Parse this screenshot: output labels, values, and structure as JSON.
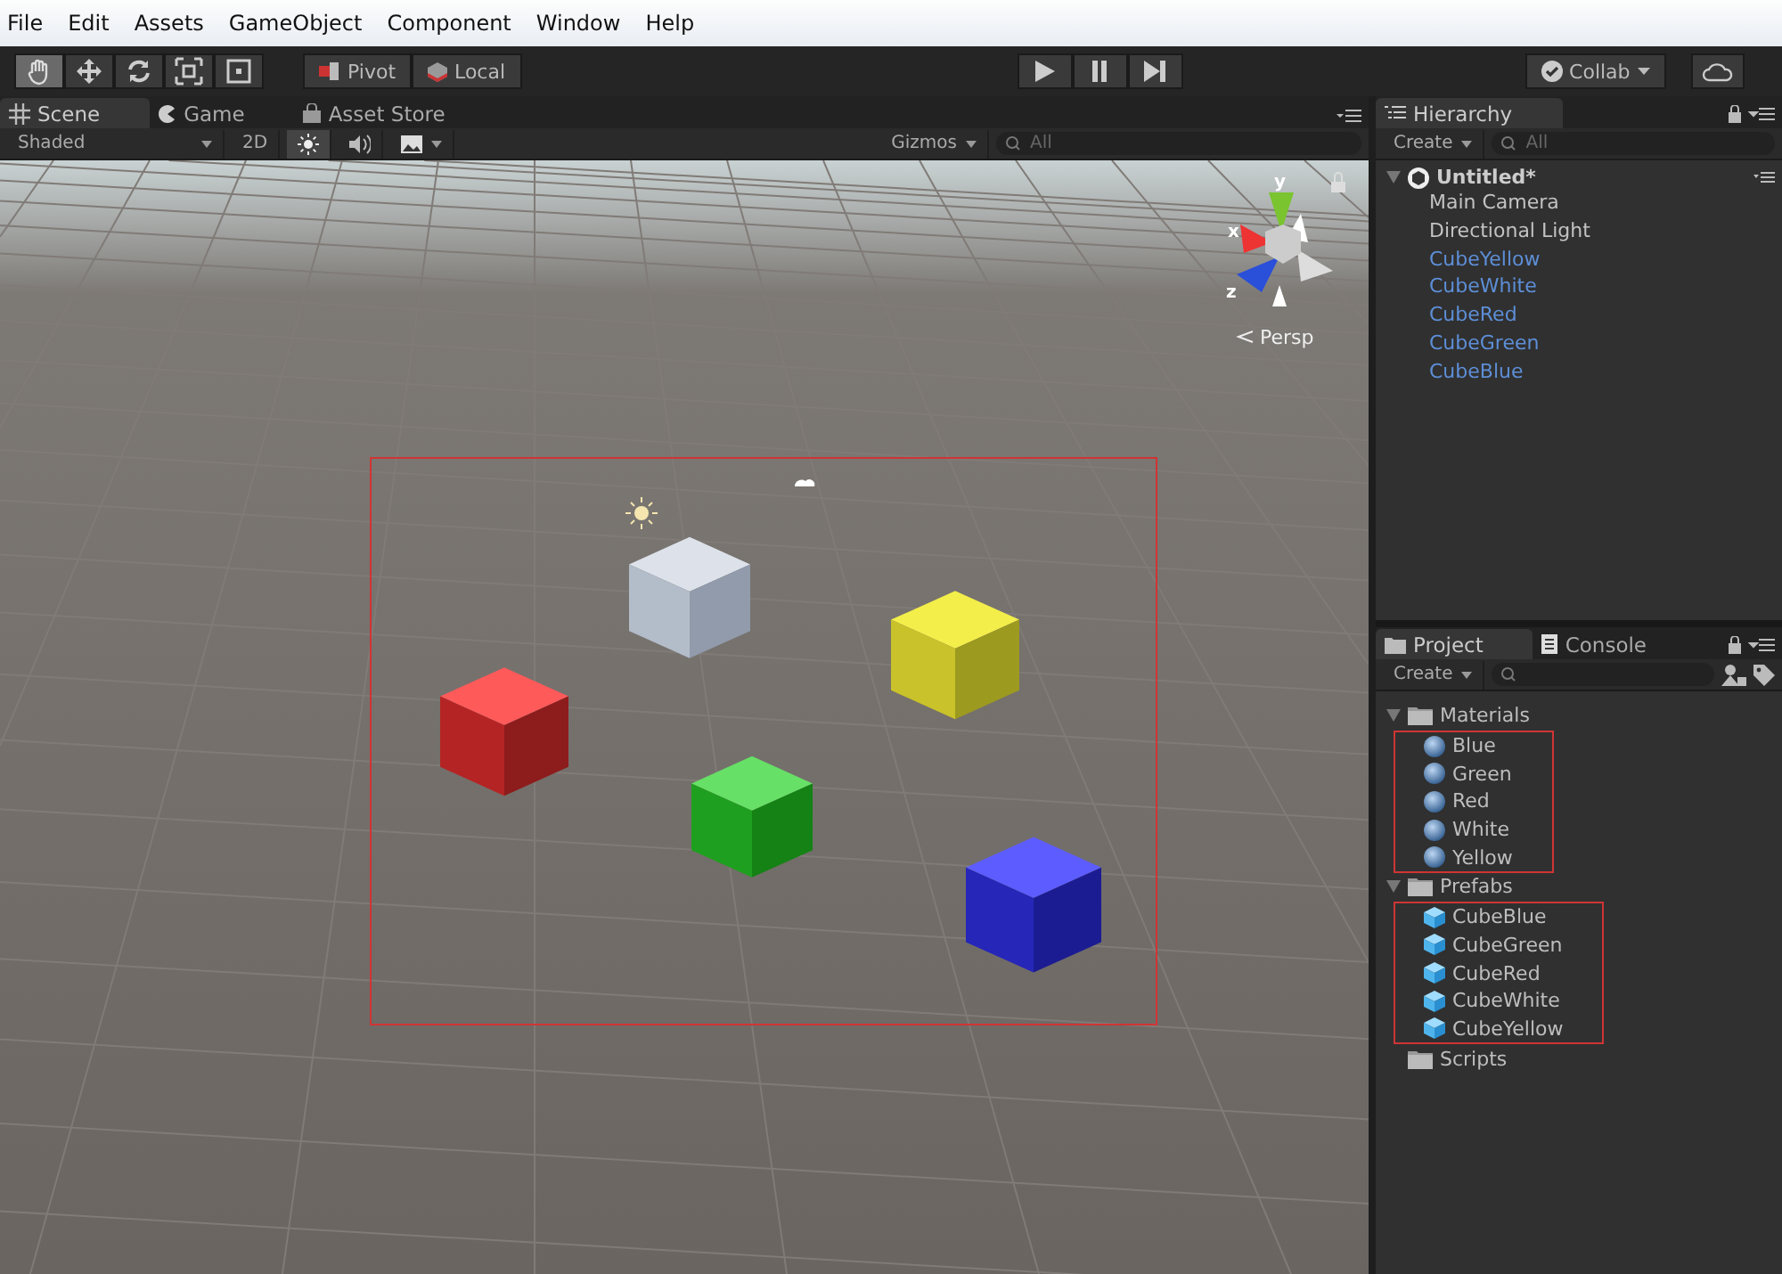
{
  "menu": [
    "File",
    "Edit",
    "Assets",
    "GameObject",
    "Component",
    "Window",
    "Help"
  ],
  "toolbar": {
    "tools": [
      {
        "kind": "hand",
        "selected": true
      },
      {
        "kind": "move",
        "selected": false
      },
      {
        "kind": "rotate",
        "selected": false
      },
      {
        "kind": "scale",
        "selected": false
      },
      {
        "kind": "rect",
        "selected": false
      }
    ],
    "pivot": "Pivot",
    "local": "Local",
    "collab": "Collab"
  },
  "scene_tabs": [
    {
      "label": "Scene",
      "kind": "scene",
      "selected": true
    },
    {
      "label": "Game",
      "kind": "game",
      "selected": false
    },
    {
      "label": "Asset Store",
      "kind": "store",
      "selected": false
    }
  ],
  "scene_toolbar": {
    "shading": "Shaded",
    "mode_2d": "2D",
    "lighting_on": true,
    "audio_on": false,
    "effects_on": false,
    "gizmos": "Gizmos",
    "search_placeholder": "All"
  },
  "gizmo": {
    "y": "y",
    "x": "x",
    "z": "z",
    "projection": "Persp"
  },
  "hierarchy": {
    "tab": "Hierarchy",
    "create": "Create",
    "search_placeholder": "All",
    "scene": "Untitled*",
    "items": [
      {
        "name": "Main Camera",
        "prefab": false
      },
      {
        "name": "Directional Light",
        "prefab": false
      },
      {
        "name": "CubeYellow",
        "prefab": true
      },
      {
        "name": "CubeWhite",
        "prefab": true
      },
      {
        "name": "CubeRed",
        "prefab": true
      },
      {
        "name": "CubeGreen",
        "prefab": true
      },
      {
        "name": "CubeBlue",
        "prefab": true
      }
    ]
  },
  "project": {
    "tabs": [
      {
        "label": "Project",
        "kind": "project",
        "selected": true
      },
      {
        "label": "Console",
        "kind": "console",
        "selected": false
      }
    ],
    "create": "Create",
    "folders": [
      {
        "name": "Materials",
        "expanded": true,
        "highlighted": true,
        "children": [
          {
            "name": "Blue",
            "kind": "material"
          },
          {
            "name": "Green",
            "kind": "material"
          },
          {
            "name": "Red",
            "kind": "material"
          },
          {
            "name": "White",
            "kind": "material"
          },
          {
            "name": "Yellow",
            "kind": "material"
          }
        ]
      },
      {
        "name": "Prefabs",
        "expanded": true,
        "highlighted": true,
        "children": [
          {
            "name": "CubeBlue",
            "kind": "prefab"
          },
          {
            "name": "CubeGreen",
            "kind": "prefab"
          },
          {
            "name": "CubeRed",
            "kind": "prefab"
          },
          {
            "name": "CubeWhite",
            "kind": "prefab"
          },
          {
            "name": "CubeYellow",
            "kind": "prefab"
          }
        ]
      },
      {
        "name": "Scripts",
        "expanded": false
      }
    ]
  }
}
